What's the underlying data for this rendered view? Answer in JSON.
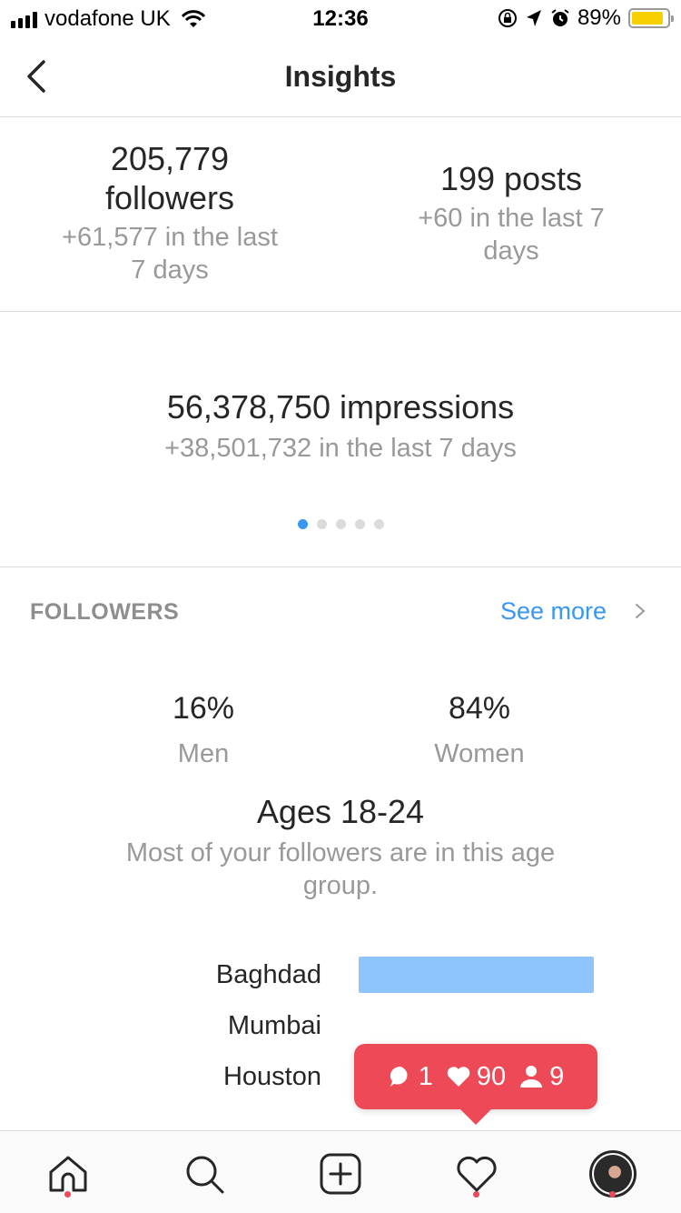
{
  "status_bar": {
    "carrier": "vodafone UK",
    "time": "12:36",
    "battery_percent": "89%",
    "battery_level": 0.89,
    "icons": [
      "signal-icon",
      "wifi-icon",
      "orientation-lock-icon",
      "location-icon",
      "alarm-icon",
      "battery-icon"
    ]
  },
  "nav": {
    "title": "Insights",
    "back_icon": "chevron-left-icon"
  },
  "stats": {
    "followers": {
      "count": "205,779",
      "label": "followers",
      "change": "+61,577 in the last 7 days"
    },
    "posts": {
      "title": "199 posts",
      "change": "+60 in the last 7 days"
    }
  },
  "impressions": {
    "title": "56,378,750 impressions",
    "change": "+38,501,732 in the last 7 days",
    "pager": {
      "count": 5,
      "active_index": 0
    }
  },
  "followers_section": {
    "header": "FOLLOWERS",
    "see_more": "See more",
    "gender": {
      "men": {
        "percent": "16%",
        "label": "Men"
      },
      "women": {
        "percent": "84%",
        "label": "Women"
      }
    },
    "ages": {
      "title": "Ages 18-24",
      "subtitle": "Most of your followers are in this age group."
    },
    "cities": [
      {
        "name": "Baghdad",
        "share": 1.0
      },
      {
        "name": "Mumbai",
        "share": 0.0
      },
      {
        "name": "Houston",
        "share": 0.0
      }
    ]
  },
  "activity_popup": {
    "comments": "1",
    "likes": "90",
    "follows": "9",
    "color": "#ed4956"
  },
  "tabbar": {
    "tabs": [
      "home-icon",
      "search-icon",
      "add-post-icon",
      "activity-heart-icon",
      "profile-avatar"
    ],
    "badge_color": "#ed4956"
  },
  "colors": {
    "accent": "#3897f0",
    "bar": "#8ec5fd",
    "muted_text": "#999999"
  }
}
